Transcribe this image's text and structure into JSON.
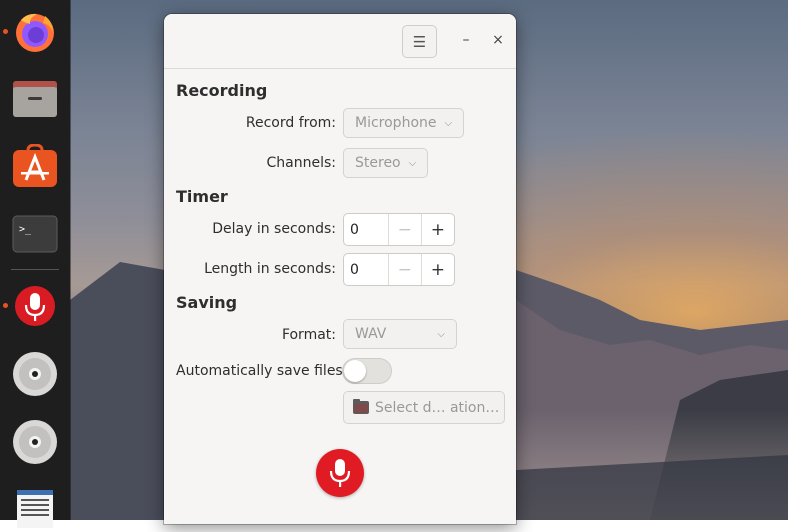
{
  "window": {
    "menu_icon": "hamburger-menu-icon",
    "minimize_icon": "minimize-icon",
    "close_icon": "close-icon",
    "minimize_glyph": "–",
    "close_glyph": "×",
    "menu_glyph": "☰"
  },
  "recording": {
    "title": "Recording",
    "record_from_label": "Record from:",
    "record_from_value": "Microphone",
    "channels_label": "Channels:",
    "channels_value": "Stereo"
  },
  "timer": {
    "title": "Timer",
    "delay_label": "Delay in seconds:",
    "delay_value": "0",
    "length_label": "Length in seconds:",
    "length_value": "0",
    "decrement_glyph": "−",
    "increment_glyph": "+"
  },
  "saving": {
    "title": "Saving",
    "format_label": "Format:",
    "format_value": "WAV",
    "autosave_label": "Automatically save files:",
    "autosave_on": false,
    "folder_button_label": "Select d… ation…"
  },
  "dock": {
    "items": [
      "firefox-icon",
      "files-icon",
      "app-center-icon",
      "terminal-icon",
      "sound-recorder-icon",
      "disc-icon",
      "disc-icon",
      "text-editor-icon"
    ]
  },
  "colors": {
    "accent_red": "#e01b24",
    "running_indicator": "#e95420",
    "dock_background": "#1e1e1e"
  }
}
